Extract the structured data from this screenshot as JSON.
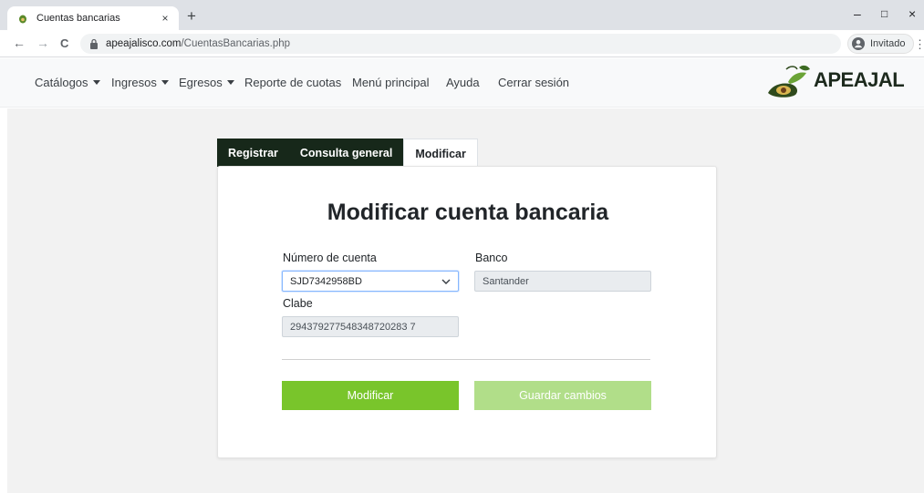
{
  "browser": {
    "tab_title": "Cuentas bancarias",
    "tab_close": "×",
    "new_tab": "+",
    "url_domain": "apeajalisco.com",
    "url_path": "/CuentasBancarias.php",
    "profile_name": "Invitado",
    "window_controls": [
      "–",
      "□",
      "×"
    ],
    "nav": {
      "back": "←",
      "forward": "→",
      "reload": "C"
    },
    "menu": "⋮"
  },
  "navbar": {
    "items": [
      {
        "label": "Catálogos",
        "dropdown": true
      },
      {
        "label": "Ingresos",
        "dropdown": true
      },
      {
        "label": "Egresos",
        "dropdown": true
      },
      {
        "label": "Reporte de cuotas",
        "dropdown": false
      },
      {
        "label": "Menú principal",
        "dropdown": false
      },
      {
        "label": "Ayuda",
        "dropdown": false
      },
      {
        "label": "Cerrar sesión",
        "dropdown": false
      }
    ],
    "logo_text": "APEAJAL"
  },
  "page_tabs": [
    {
      "label": "Registrar",
      "active": false
    },
    {
      "label": "Consulta general",
      "active": false
    },
    {
      "label": "Modificar",
      "active": true
    }
  ],
  "form": {
    "title": "Modificar cuenta bancaria",
    "numero_label": "Número de cuenta",
    "numero_value": "SJD7342958BD",
    "banco_label": "Banco",
    "banco_value": "Santander",
    "clabe_label": "Clabe",
    "clabe_value": "294379277548348720283 7",
    "modificar_label": "Modificar",
    "guardar_label": "Guardar cambios"
  },
  "colors": {
    "accent_green": "#79c52b",
    "disabled_green": "#b1de89",
    "tab_dark": "#17281a"
  }
}
